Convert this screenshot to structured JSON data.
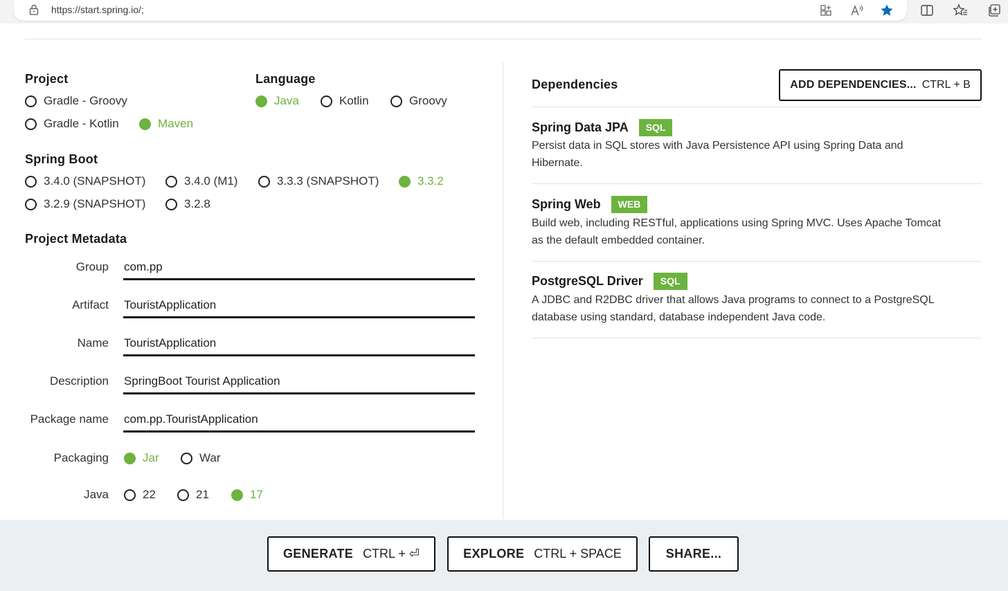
{
  "browser": {
    "url": "https://start.spring.io/;",
    "icons": [
      "lock-icon",
      "apps-icon",
      "read-aloud-icon",
      "favorite-star-icon",
      "split-screen-icon",
      "favorites-icon",
      "collections-icon"
    ],
    "accent_color": "#0f6cbd"
  },
  "theme": {
    "accent": "#6db33f",
    "footer_bg": "#ebeff1"
  },
  "project": {
    "title": "Project",
    "options": [
      "Gradle - Groovy",
      "Gradle - Kotlin",
      "Maven"
    ],
    "selected": "Maven"
  },
  "language": {
    "title": "Language",
    "options": [
      "Java",
      "Kotlin",
      "Groovy"
    ],
    "selected": "Java"
  },
  "spring_boot": {
    "title": "Spring Boot",
    "options": [
      "3.4.0 (SNAPSHOT)",
      "3.4.0 (M1)",
      "3.3.3 (SNAPSHOT)",
      "3.3.2",
      "3.2.9 (SNAPSHOT)",
      "3.2.8"
    ],
    "selected": "3.3.2"
  },
  "metadata": {
    "title": "Project Metadata",
    "group": {
      "label": "Group",
      "value": "com.pp"
    },
    "artifact": {
      "label": "Artifact",
      "value": "TouristApplication"
    },
    "name": {
      "label": "Name",
      "value": "TouristApplication"
    },
    "description": {
      "label": "Description",
      "value": "SpringBoot Tourist Application"
    },
    "package_name": {
      "label": "Package name",
      "value": "com.pp.TouristApplication"
    },
    "packaging": {
      "label": "Packaging",
      "options": [
        "Jar",
        "War"
      ],
      "selected": "Jar"
    },
    "java": {
      "label": "Java",
      "options": [
        "22",
        "21",
        "17"
      ],
      "selected": "17"
    }
  },
  "dependencies": {
    "title": "Dependencies",
    "add_button": {
      "label": "ADD DEPENDENCIES...",
      "shortcut": "CTRL + B"
    },
    "items": [
      {
        "name": "Spring Data JPA",
        "badge": "SQL",
        "description": "Persist data in SQL stores with Java Persistence API using Spring Data and Hibernate."
      },
      {
        "name": "Spring Web",
        "badge": "WEB",
        "description": "Build web, including RESTful, applications using Spring MVC. Uses Apache Tomcat as the default embedded container."
      },
      {
        "name": "PostgreSQL Driver",
        "badge": "SQL",
        "description": "A JDBC and R2DBC driver that allows Java programs to connect to a PostgreSQL database using standard, database independent Java code."
      }
    ]
  },
  "footer": {
    "generate": {
      "label": "GENERATE",
      "shortcut": "CTRL + ⏎"
    },
    "explore": {
      "label": "EXPLORE",
      "shortcut": "CTRL + SPACE"
    },
    "share": {
      "label": "SHARE..."
    }
  }
}
